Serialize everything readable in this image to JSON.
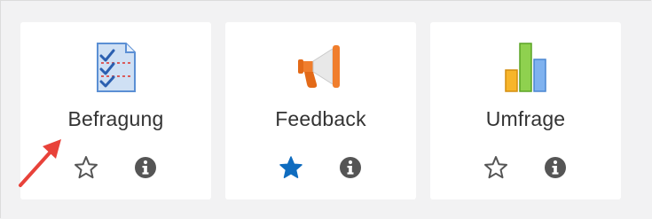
{
  "cards": [
    {
      "label": "Befragung",
      "icon": "questionnaire-checklist-icon",
      "starred": false
    },
    {
      "label": "Feedback",
      "icon": "megaphone-icon",
      "starred": true
    },
    {
      "label": "Umfrage",
      "icon": "bar-chart-icon",
      "starred": false
    }
  ],
  "colors": {
    "star_active": "#0f6cbf",
    "star_inactive": "#555555",
    "info": "#555555",
    "annotation_arrow": "#e8423a"
  }
}
